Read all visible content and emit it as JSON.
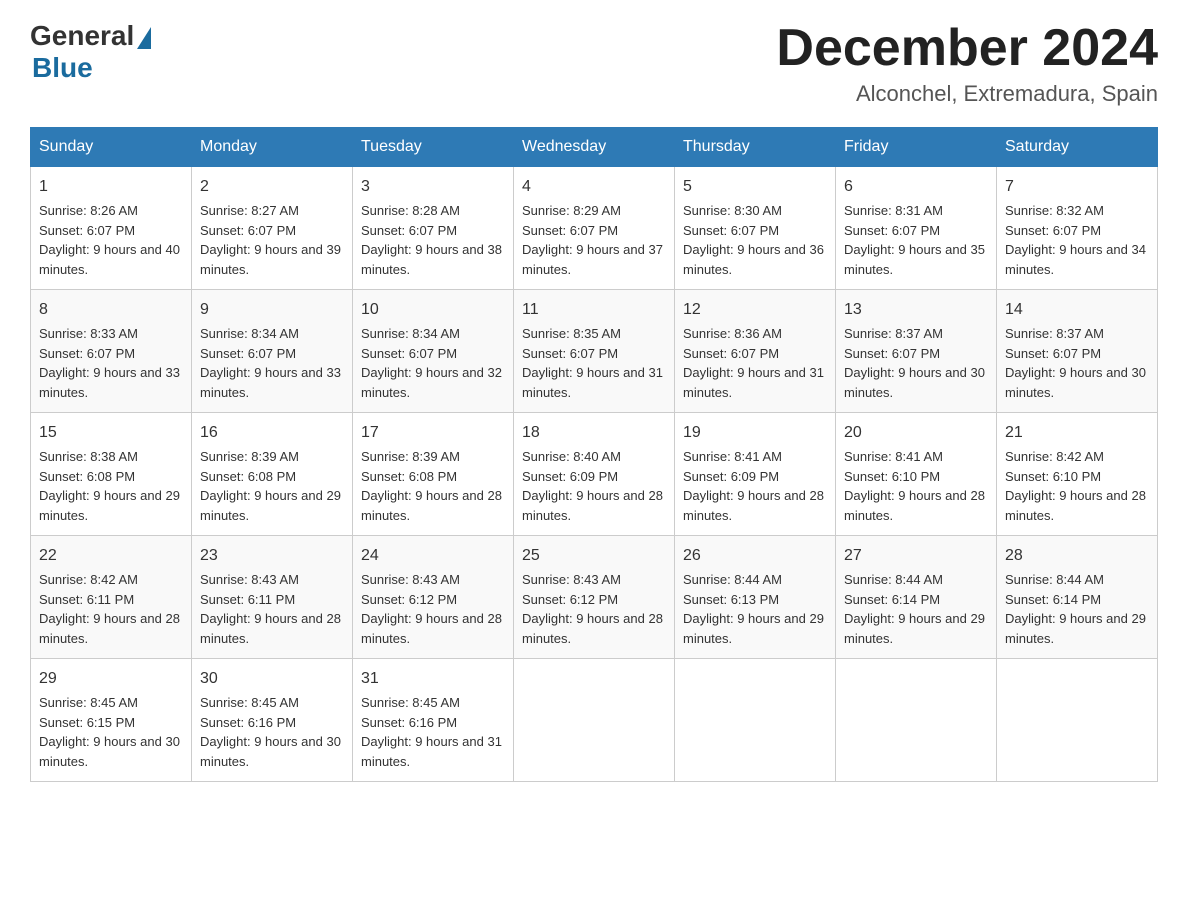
{
  "logo": {
    "general": "General",
    "blue": "Blue"
  },
  "title": "December 2024",
  "location": "Alconchel, Extremadura, Spain",
  "days_of_week": [
    "Sunday",
    "Monday",
    "Tuesday",
    "Wednesday",
    "Thursday",
    "Friday",
    "Saturday"
  ],
  "weeks": [
    [
      {
        "num": "1",
        "sunrise": "8:26 AM",
        "sunset": "6:07 PM",
        "daylight": "9 hours and 40 minutes."
      },
      {
        "num": "2",
        "sunrise": "8:27 AM",
        "sunset": "6:07 PM",
        "daylight": "9 hours and 39 minutes."
      },
      {
        "num": "3",
        "sunrise": "8:28 AM",
        "sunset": "6:07 PM",
        "daylight": "9 hours and 38 minutes."
      },
      {
        "num": "4",
        "sunrise": "8:29 AM",
        "sunset": "6:07 PM",
        "daylight": "9 hours and 37 minutes."
      },
      {
        "num": "5",
        "sunrise": "8:30 AM",
        "sunset": "6:07 PM",
        "daylight": "9 hours and 36 minutes."
      },
      {
        "num": "6",
        "sunrise": "8:31 AM",
        "sunset": "6:07 PM",
        "daylight": "9 hours and 35 minutes."
      },
      {
        "num": "7",
        "sunrise": "8:32 AM",
        "sunset": "6:07 PM",
        "daylight": "9 hours and 34 minutes."
      }
    ],
    [
      {
        "num": "8",
        "sunrise": "8:33 AM",
        "sunset": "6:07 PM",
        "daylight": "9 hours and 33 minutes."
      },
      {
        "num": "9",
        "sunrise": "8:34 AM",
        "sunset": "6:07 PM",
        "daylight": "9 hours and 33 minutes."
      },
      {
        "num": "10",
        "sunrise": "8:34 AM",
        "sunset": "6:07 PM",
        "daylight": "9 hours and 32 minutes."
      },
      {
        "num": "11",
        "sunrise": "8:35 AM",
        "sunset": "6:07 PM",
        "daylight": "9 hours and 31 minutes."
      },
      {
        "num": "12",
        "sunrise": "8:36 AM",
        "sunset": "6:07 PM",
        "daylight": "9 hours and 31 minutes."
      },
      {
        "num": "13",
        "sunrise": "8:37 AM",
        "sunset": "6:07 PM",
        "daylight": "9 hours and 30 minutes."
      },
      {
        "num": "14",
        "sunrise": "8:37 AM",
        "sunset": "6:07 PM",
        "daylight": "9 hours and 30 minutes."
      }
    ],
    [
      {
        "num": "15",
        "sunrise": "8:38 AM",
        "sunset": "6:08 PM",
        "daylight": "9 hours and 29 minutes."
      },
      {
        "num": "16",
        "sunrise": "8:39 AM",
        "sunset": "6:08 PM",
        "daylight": "9 hours and 29 minutes."
      },
      {
        "num": "17",
        "sunrise": "8:39 AM",
        "sunset": "6:08 PM",
        "daylight": "9 hours and 28 minutes."
      },
      {
        "num": "18",
        "sunrise": "8:40 AM",
        "sunset": "6:09 PM",
        "daylight": "9 hours and 28 minutes."
      },
      {
        "num": "19",
        "sunrise": "8:41 AM",
        "sunset": "6:09 PM",
        "daylight": "9 hours and 28 minutes."
      },
      {
        "num": "20",
        "sunrise": "8:41 AM",
        "sunset": "6:10 PM",
        "daylight": "9 hours and 28 minutes."
      },
      {
        "num": "21",
        "sunrise": "8:42 AM",
        "sunset": "6:10 PM",
        "daylight": "9 hours and 28 minutes."
      }
    ],
    [
      {
        "num": "22",
        "sunrise": "8:42 AM",
        "sunset": "6:11 PM",
        "daylight": "9 hours and 28 minutes."
      },
      {
        "num": "23",
        "sunrise": "8:43 AM",
        "sunset": "6:11 PM",
        "daylight": "9 hours and 28 minutes."
      },
      {
        "num": "24",
        "sunrise": "8:43 AM",
        "sunset": "6:12 PM",
        "daylight": "9 hours and 28 minutes."
      },
      {
        "num": "25",
        "sunrise": "8:43 AM",
        "sunset": "6:12 PM",
        "daylight": "9 hours and 28 minutes."
      },
      {
        "num": "26",
        "sunrise": "8:44 AM",
        "sunset": "6:13 PM",
        "daylight": "9 hours and 29 minutes."
      },
      {
        "num": "27",
        "sunrise": "8:44 AM",
        "sunset": "6:14 PM",
        "daylight": "9 hours and 29 minutes."
      },
      {
        "num": "28",
        "sunrise": "8:44 AM",
        "sunset": "6:14 PM",
        "daylight": "9 hours and 29 minutes."
      }
    ],
    [
      {
        "num": "29",
        "sunrise": "8:45 AM",
        "sunset": "6:15 PM",
        "daylight": "9 hours and 30 minutes."
      },
      {
        "num": "30",
        "sunrise": "8:45 AM",
        "sunset": "6:16 PM",
        "daylight": "9 hours and 30 minutes."
      },
      {
        "num": "31",
        "sunrise": "8:45 AM",
        "sunset": "6:16 PM",
        "daylight": "9 hours and 31 minutes."
      },
      null,
      null,
      null,
      null
    ]
  ]
}
